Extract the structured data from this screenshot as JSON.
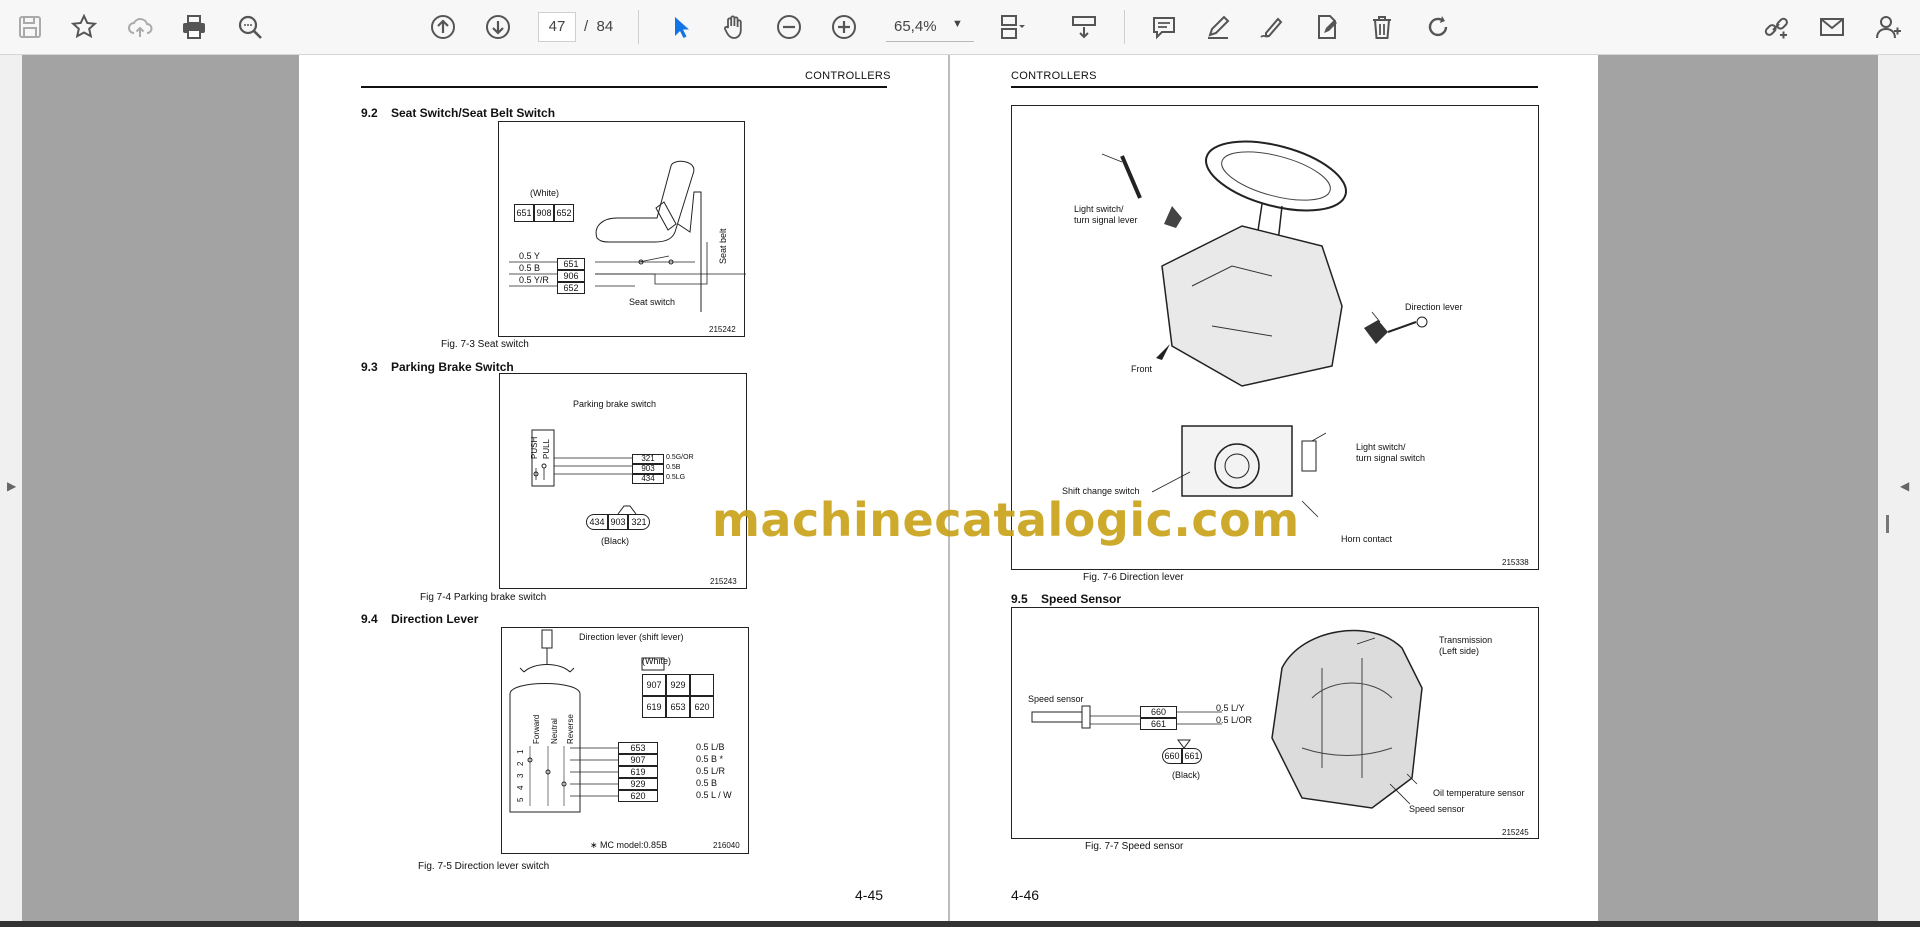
{
  "toolbar": {
    "current_page": "47",
    "page_sep": "/",
    "total_pages": "84",
    "zoom": "65,4%",
    "icons": [
      "save-icon",
      "bookmark-star-icon",
      "upload-cloud-icon",
      "print-icon",
      "zoom-search-icon",
      "page-up-icon",
      "page-down-icon",
      "select-pointer-icon",
      "hand-pan-icon",
      "zoom-out-icon",
      "zoom-in-icon",
      "page-fit-icon",
      "scroll-mode-icon",
      "comment-icon",
      "highlight-pen-icon",
      "sign-pen-icon",
      "edit-pages-icon",
      "delete-icon",
      "rotate-icon",
      "share-link-icon",
      "email-icon",
      "add-user-icon"
    ],
    "accent": "#1473e6"
  },
  "watermark": "machinecatalogic.com",
  "left_page": {
    "header": "CONTROLLERS",
    "page_number": "4-45",
    "sec_92": {
      "num": "9.2",
      "title": "Seat Switch/Seat Belt Switch"
    },
    "fig73": {
      "white": "(White)",
      "conn": [
        "651",
        "908",
        "652"
      ],
      "wires": [
        "0.5 Y",
        "0.5 B",
        "0.5 Y/R"
      ],
      "terms": [
        "651",
        "906",
        "652"
      ],
      "seat_switch": "Seat switch",
      "seat_belt": "Seat belt",
      "num": "215242",
      "caption": "Fig. 7-3 Seat switch"
    },
    "sec_93": {
      "num": "9.3",
      "title": "Parking Brake Switch"
    },
    "fig74": {
      "title": "Parking brake switch",
      "push": "PUSH",
      "pull": "PULL",
      "terms": [
        "321",
        "903",
        "434"
      ],
      "wires": [
        "0.5G/OR",
        "0.5B",
        "0.5LG"
      ],
      "conn": [
        "434",
        "903",
        "321"
      ],
      "black": "(Black)",
      "num": "215243",
      "caption": "Fig 7-4 Parking brake switch"
    },
    "sec_94": {
      "num": "9.4",
      "title": "Direction Lever"
    },
    "fig75": {
      "title": "Direction lever (shift lever)",
      "white": "(White)",
      "conn_row1": [
        "907",
        "929",
        ""
      ],
      "conn_row2": [
        "619",
        "653",
        "620"
      ],
      "positions": [
        "Forward",
        "Neutral",
        "Reverse"
      ],
      "pins": [
        "1",
        "2",
        "3",
        "4",
        "5"
      ],
      "terms": [
        "653",
        "907",
        "619",
        "929",
        "620"
      ],
      "wires": [
        "0.5  L/B",
        "0.5  B *",
        "0.5  L/R",
        "0.5  B",
        "0.5  L / W"
      ],
      "note": "∗ MC model:0.85B",
      "num": "216040",
      "caption": "Fig. 7-5 Direction lever switch"
    }
  },
  "right_page": {
    "header": "CONTROLLERS",
    "page_number": "4-46",
    "fig76": {
      "light_switch": "Light switch/\nturn signal lever",
      "direction_lever": "Direction lever",
      "front": "Front",
      "light_switch2": "Light switch/\nturn signal switch",
      "shift_change": "Shift change switch",
      "horn": "Horn contact",
      "num": "215338",
      "caption": "Fig. 7-6 Direction lever"
    },
    "sec_95": {
      "num": "9.5",
      "title": "Speed Sensor"
    },
    "fig77": {
      "speed_sensor": "Speed sensor",
      "terms": [
        "660",
        "661"
      ],
      "wires": [
        "0.5  L/Y",
        "0.5  L/OR"
      ],
      "conn": [
        "660",
        "661"
      ],
      "black": "(Black)",
      "transmission": "Transmission\n(Left side)",
      "oil_temp": "Oil temperature sensor",
      "speed_sensor2": "Speed sensor",
      "num": "215245",
      "caption": "Fig. 7-7 Speed sensor"
    }
  }
}
